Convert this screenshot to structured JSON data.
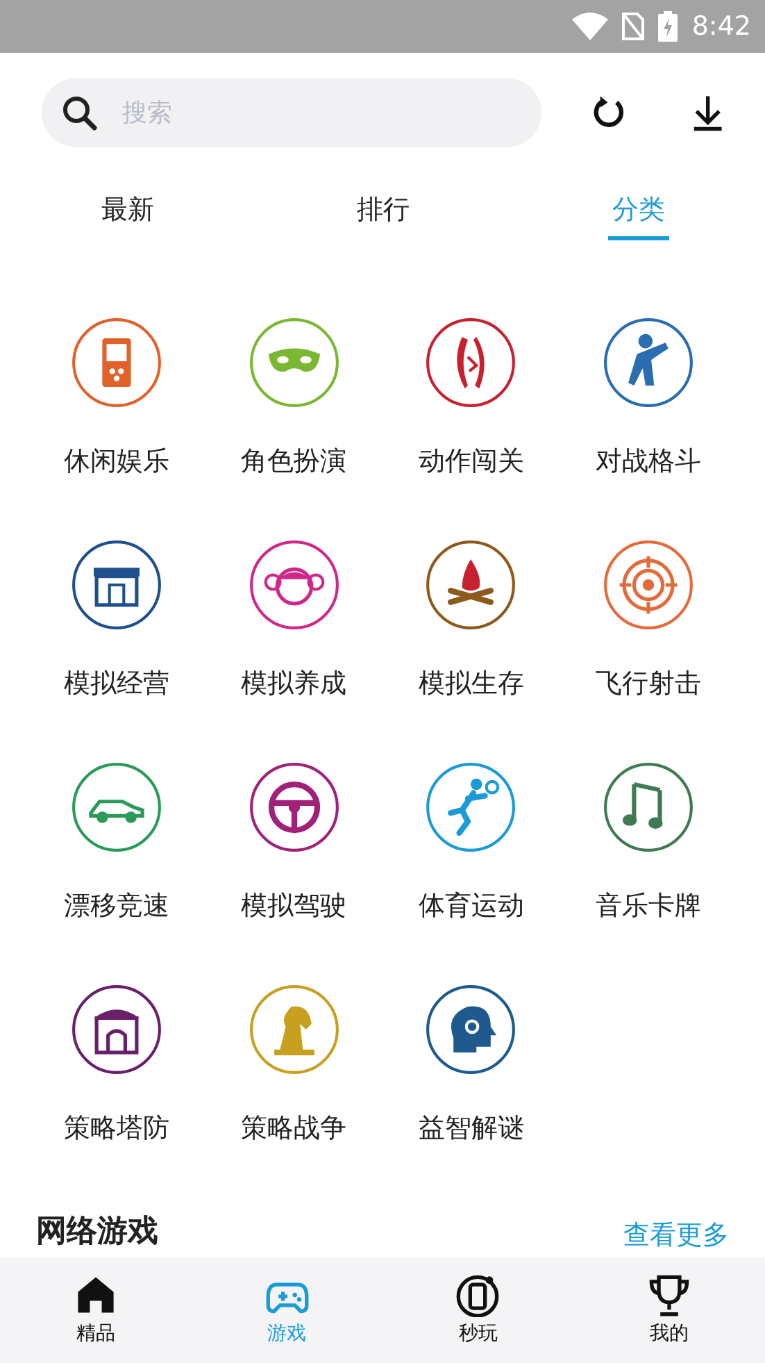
{
  "status_bar": {
    "time": "8:42"
  },
  "search": {
    "placeholder": "搜索"
  },
  "tabs": [
    {
      "label": "最新",
      "selected": false
    },
    {
      "label": "排行",
      "selected": false
    },
    {
      "label": "分类",
      "selected": true
    }
  ],
  "categories": [
    {
      "label": "休闲娱乐",
      "kind": "handheld",
      "color": "#e0622a"
    },
    {
      "label": "角色扮演",
      "kind": "mask",
      "color": "#7ab833"
    },
    {
      "label": "动作闯关",
      "kind": "blade",
      "color": "#c8202f"
    },
    {
      "label": "对战格斗",
      "kind": "fighter",
      "color": "#2a6db0"
    },
    {
      "label": "模拟经营",
      "kind": "shop",
      "color": "#1f4f8f"
    },
    {
      "label": "模拟养成",
      "kind": "girl",
      "color": "#d0288a"
    },
    {
      "label": "模拟生存",
      "kind": "fire",
      "color": "#8b5a1c"
    },
    {
      "label": "飞行射击",
      "kind": "target",
      "color": "#e46a3a"
    },
    {
      "label": "漂移竞速",
      "kind": "car",
      "color": "#2a9a58"
    },
    {
      "label": "模拟驾驶",
      "kind": "wheel",
      "color": "#a0207a"
    },
    {
      "label": "体育运动",
      "kind": "tennis",
      "color": "#1a9bd7"
    },
    {
      "label": "音乐卡牌",
      "kind": "music",
      "color": "#3f7a55"
    },
    {
      "label": "策略塔防",
      "kind": "tower",
      "color": "#6a1f6a"
    },
    {
      "label": "策略战争",
      "kind": "knight",
      "color": "#c8a020"
    },
    {
      "label": "益智解谜",
      "kind": "head",
      "color": "#1f5a8f"
    }
  ],
  "section": {
    "title": "网络游戏",
    "more": "查看更多"
  },
  "nav": [
    {
      "label": "精品",
      "kind": "home",
      "selected": false
    },
    {
      "label": "游戏",
      "kind": "gamepad",
      "selected": true
    },
    {
      "label": "秒玩",
      "kind": "phone",
      "selected": false
    },
    {
      "label": "我的",
      "kind": "trophy",
      "selected": false
    }
  ]
}
